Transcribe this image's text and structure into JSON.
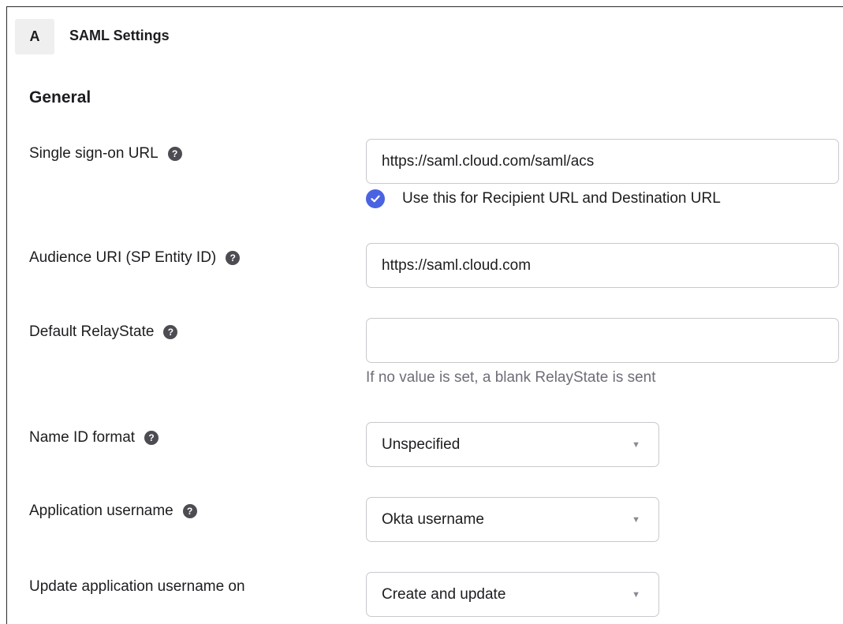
{
  "header": {
    "step_letter": "A",
    "title": "SAML Settings"
  },
  "section": {
    "title": "General"
  },
  "fields": {
    "sso_url": {
      "label": "Single sign-on URL",
      "value": "https://saml.cloud.com/saml/acs",
      "checkbox_label": "Use this for Recipient URL and Destination URL",
      "checkbox_checked": true
    },
    "audience_uri": {
      "label": "Audience URI (SP Entity ID)",
      "value": "https://saml.cloud.com"
    },
    "relay_state": {
      "label": "Default RelayState",
      "value": "",
      "hint": "If no value is set, a blank RelayState is sent"
    },
    "name_id_format": {
      "label": "Name ID format",
      "value": "Unspecified"
    },
    "app_username": {
      "label": "Application username",
      "value": "Okta username"
    },
    "update_username_on": {
      "label": "Update application username on",
      "value": "Create and update"
    }
  },
  "icons": {
    "help": "help-icon",
    "checkbox": "check-icon",
    "dropdown": "caret-down-icon"
  },
  "colors": {
    "accent": "#4a63e2",
    "text": "#1d1d21",
    "muted": "#6e6e78",
    "border": "#c9c9ce",
    "badge_bg": "#efeff0"
  },
  "help_glyph": "?",
  "caret_glyph": "▼"
}
